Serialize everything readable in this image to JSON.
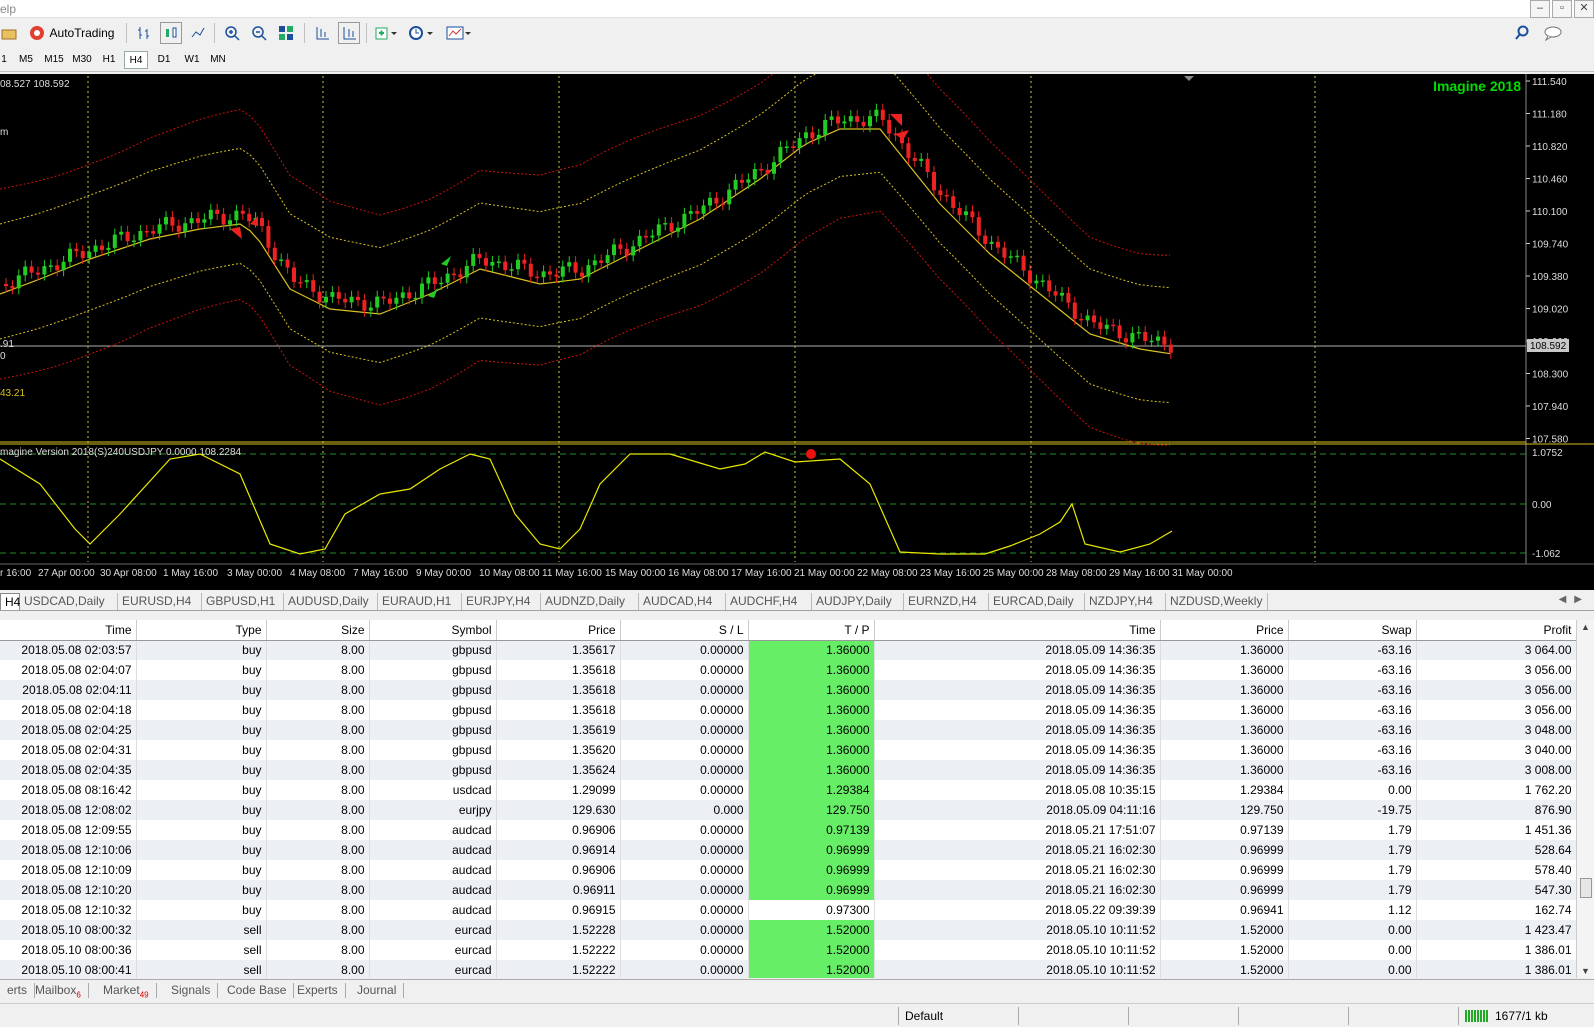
{
  "menubar": {
    "text": "elp"
  },
  "window_controls": {
    "minimize": "–",
    "restore": "▫",
    "close": "✕"
  },
  "toolbar": {
    "autotrading_label": "AutoTrading"
  },
  "timeframes": [
    "1",
    "M5",
    "M15",
    "M30",
    "H1",
    "H4",
    "D1",
    "W1",
    "MN"
  ],
  "active_timeframe": "H4",
  "chart": {
    "header_text": "08.527 108.592",
    "watermark": "Imagine 2018",
    "current_price": "108.592",
    "left_labels": [
      "m",
      ".91",
      "0",
      "43.21"
    ],
    "price_scale": [
      "111.540",
      "111.180",
      "110.820",
      "110.460",
      "110.100",
      "109.740",
      "109.380",
      "109.020",
      "108.660",
      "108.300",
      "107.940",
      "107.580"
    ],
    "indicator_label": "magine Version 2018(S)240USDJPY 0.0000 108.2284",
    "indicator_scale": [
      "1.0752",
      "0.00",
      "-1.062"
    ],
    "time_labels": [
      "r 16:00",
      "27 Apr 00:00",
      "30 Apr 08:00",
      "1 May 16:00",
      "3 May 00:00",
      "4 May 08:00",
      "7 May 16:00",
      "9 May 00:00",
      "10 May 08:00",
      "11 May 16:00",
      "15 May 00:00",
      "16 May 08:00",
      "17 May 16:00",
      "21 May 00:00",
      "22 May 08:00",
      "23 May 16:00",
      "25 May 00:00",
      "28 May 08:00",
      "29 May 16:00",
      "31 May 00:00"
    ],
    "colors": {
      "bull": "#22cc22",
      "bear": "#ee2222",
      "ma": "#d8c020",
      "band_inner": "#d8c020",
      "band_outer": "#cc1111",
      "grid": "#c8c840",
      "watermark": "#00dd00",
      "indicator_line": "#e8e800",
      "price_line": "#b0b0b0"
    }
  },
  "symbol_tabs": [
    "H4",
    "USDCAD,Daily",
    "EURUSD,H4",
    "GBPUSD,H1",
    "AUDUSD,Daily",
    "EURAUD,H1",
    "EURJPY,H4",
    "AUDNZD,Daily",
    "AUDCAD,H4",
    "AUDCHF,H4",
    "AUDJPY,Daily",
    "EURNZD,H4",
    "EURCAD,Daily",
    "NZDJPY,H4",
    "NZDUSD,Weekly"
  ],
  "table": {
    "columns": [
      "Time",
      "Type",
      "Size",
      "Symbol",
      "Price",
      "S / L",
      "T / P",
      "Time",
      "Price",
      "Swap",
      "Profit"
    ],
    "rows": [
      [
        "2018.05.08 02:03:57",
        "buy",
        "8.00",
        "gbpusd",
        "1.35617",
        "0.00000",
        "1.36000",
        "2018.05.09 14:36:35",
        "1.36000",
        "-63.16",
        "3 064.00"
      ],
      [
        "2018.05.08 02:04:07",
        "buy",
        "8.00",
        "gbpusd",
        "1.35618",
        "0.00000",
        "1.36000",
        "2018.05.09 14:36:35",
        "1.36000",
        "-63.16",
        "3 056.00"
      ],
      [
        "2018.05.08 02:04:11",
        "buy",
        "8.00",
        "gbpusd",
        "1.35618",
        "0.00000",
        "1.36000",
        "2018.05.09 14:36:35",
        "1.36000",
        "-63.16",
        "3 056.00"
      ],
      [
        "2018.05.08 02:04:18",
        "buy",
        "8.00",
        "gbpusd",
        "1.35618",
        "0.00000",
        "1.36000",
        "2018.05.09 14:36:35",
        "1.36000",
        "-63.16",
        "3 056.00"
      ],
      [
        "2018.05.08 02:04:25",
        "buy",
        "8.00",
        "gbpusd",
        "1.35619",
        "0.00000",
        "1.36000",
        "2018.05.09 14:36:35",
        "1.36000",
        "-63.16",
        "3 048.00"
      ],
      [
        "2018.05.08 02:04:31",
        "buy",
        "8.00",
        "gbpusd",
        "1.35620",
        "0.00000",
        "1.36000",
        "2018.05.09 14:36:35",
        "1.36000",
        "-63.16",
        "3 040.00"
      ],
      [
        "2018.05.08 02:04:35",
        "buy",
        "8.00",
        "gbpusd",
        "1.35624",
        "0.00000",
        "1.36000",
        "2018.05.09 14:36:35",
        "1.36000",
        "-63.16",
        "3 008.00"
      ],
      [
        "2018.05.08 08:16:42",
        "buy",
        "8.00",
        "usdcad",
        "1.29099",
        "0.00000",
        "1.29384",
        "2018.05.08 10:35:15",
        "1.29384",
        "0.00",
        "1 762.20"
      ],
      [
        "2018.05.08 12:08:02",
        "buy",
        "8.00",
        "eurjpy",
        "129.630",
        "0.000",
        "129.750",
        "2018.05.09 04:11:16",
        "129.750",
        "-19.75",
        "876.90"
      ],
      [
        "2018.05.08 12:09:55",
        "buy",
        "8.00",
        "audcad",
        "0.96906",
        "0.00000",
        "0.97139",
        "2018.05.21 17:51:07",
        "0.97139",
        "1.79",
        "1 451.36"
      ],
      [
        "2018.05.08 12:10:06",
        "buy",
        "8.00",
        "audcad",
        "0.96914",
        "0.00000",
        "0.96999",
        "2018.05.21 16:02:30",
        "0.96999",
        "1.79",
        "528.64"
      ],
      [
        "2018.05.08 12:10:09",
        "buy",
        "8.00",
        "audcad",
        "0.96906",
        "0.00000",
        "0.96999",
        "2018.05.21 16:02:30",
        "0.96999",
        "1.79",
        "578.40"
      ],
      [
        "2018.05.08 12:10:20",
        "buy",
        "8.00",
        "audcad",
        "0.96911",
        "0.00000",
        "0.96999",
        "2018.05.21 16:02:30",
        "0.96999",
        "1.79",
        "547.30"
      ],
      [
        "2018.05.08 12:10:32",
        "buy",
        "8.00",
        "audcad",
        "0.96915",
        "0.00000",
        "0.97300",
        "2018.05.22 09:39:39",
        "0.96941",
        "1.12",
        "162.74"
      ],
      [
        "2018.05.10 08:00:32",
        "sell",
        "8.00",
        "eurcad",
        "1.52228",
        "0.00000",
        "1.52000",
        "2018.05.10 10:11:52",
        "1.52000",
        "0.00",
        "1 423.47"
      ],
      [
        "2018.05.10 08:00:36",
        "sell",
        "8.00",
        "eurcad",
        "1.52222",
        "0.00000",
        "1.52000",
        "2018.05.10 10:11:52",
        "1.52000",
        "0.00",
        "1 386.01"
      ],
      [
        "2018.05.10 08:00:41",
        "sell",
        "8.00",
        "eurcad",
        "1.52222",
        "0.00000",
        "1.52000",
        "2018.05.10 10:11:52",
        "1.52000",
        "0.00",
        "1 386.01"
      ]
    ],
    "tp_hit_rows": [
      0,
      1,
      2,
      3,
      4,
      5,
      6,
      7,
      8,
      9,
      10,
      11,
      12,
      14,
      15,
      16
    ],
    "tp_hit_color": "#66ee66"
  },
  "bottom_tabs": [
    {
      "label": "erts",
      "badge": ""
    },
    {
      "label": "Mailbox",
      "badge": "6"
    },
    {
      "label": "Market",
      "badge": "49"
    },
    {
      "label": "Signals",
      "badge": ""
    },
    {
      "label": "Code Base",
      "badge": ""
    },
    {
      "label": "Experts",
      "badge": ""
    },
    {
      "label": "Journal",
      "badge": ""
    }
  ],
  "status": {
    "profile": "Default",
    "traffic": "1677/1 kb"
  }
}
